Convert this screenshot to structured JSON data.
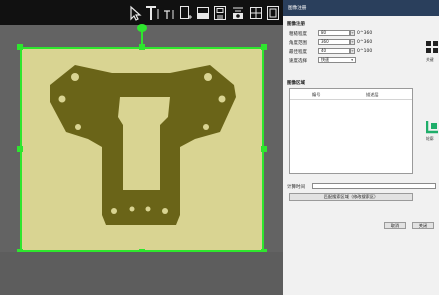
{
  "toolbar": {
    "tools": [
      {
        "icon": "arrow-select-icon",
        "glyph": ""
      },
      {
        "icon": "text-tool-icon",
        "glyph": "T|"
      },
      {
        "icon": "text-small-tool-icon",
        "glyph": "T|"
      },
      {
        "icon": "roi-add-icon",
        "glyph": ""
      },
      {
        "icon": "rectangle-fill-icon",
        "glyph": ""
      },
      {
        "icon": "image-save-icon",
        "glyph": ""
      },
      {
        "icon": "mask-icon",
        "glyph": ""
      },
      {
        "icon": "grid-icon",
        "glyph": ""
      },
      {
        "icon": "fit-view-icon",
        "glyph": ""
      }
    ]
  },
  "colors": {
    "roi": "#2ee62e",
    "part": "#6a6418",
    "plate": "#d9d492",
    "titlebar": "#2a3f5c"
  },
  "dialog": {
    "title": "图像注册",
    "params_section": "图像注册",
    "fields": [
      {
        "label": "粗糙程度",
        "value": "80",
        "unit": "0^360"
      },
      {
        "label": "角度范围",
        "value": "360",
        "unit": "0^360"
      },
      {
        "label": "最佳程度",
        "value": "40",
        "unit": "0^100"
      }
    ],
    "speed": {
      "label": "速度选择",
      "value": "快速"
    },
    "list_section": "图像区域",
    "table_headers": [
      "编号",
      "描述层"
    ],
    "filter_label": "计算时间",
    "filter_value": "",
    "wide_button": "匹配搜索区域（修改搜索区）",
    "ok_button": "取消",
    "cancel_button": "关闭",
    "side_labels": [
      "关键",
      "轮廓"
    ]
  }
}
